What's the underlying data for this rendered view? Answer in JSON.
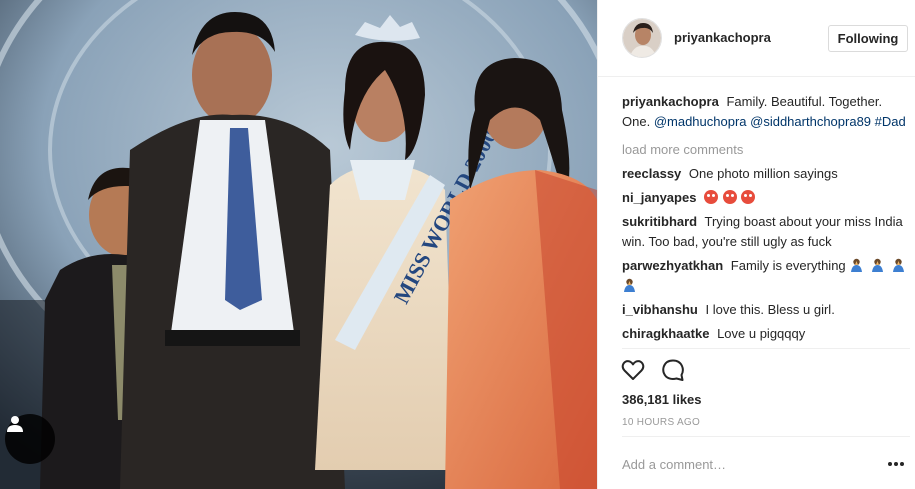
{
  "post": {
    "username": "priyankachopra",
    "follow_label": "Following",
    "caption": {
      "author": "priyankachopra",
      "text": "Family. Beautiful. Together. One.",
      "mention1": "@madhuchopra",
      "mention2": "@siddharthchopra89",
      "hashtag": "#Dad"
    },
    "load_more": "load more comments",
    "comments": [
      {
        "user": "reeclassy",
        "text": "One photo million sayings"
      },
      {
        "user": "ni_janyapes",
        "text": "",
        "emoji": "heart-eyes-emoji x3"
      },
      {
        "user": "sukritibhard",
        "text": "Trying boast about your miss India win. Too bad, you're still ugly as fuck"
      },
      {
        "user": "parwezhyatkhan",
        "text": "Family is everything",
        "emoji": "praying-hands-emoji x4"
      },
      {
        "user": "i_vibhanshu",
        "text": "I love this. Bless u girl."
      },
      {
        "user": "chiragkhaatke",
        "text": "Love u pigqqqy"
      }
    ],
    "likes": "386,181 likes",
    "time_ago": "10 HOURS AGO",
    "comment_placeholder": "Add a comment…"
  },
  "icons": {
    "like": "heart-icon",
    "comment": "comment-icon",
    "more": "more-options-icon",
    "tag": "user-tag-icon"
  },
  "colors": {
    "text": "#262626",
    "muted": "#999999",
    "link": "#003569",
    "border": "#efefef"
  }
}
